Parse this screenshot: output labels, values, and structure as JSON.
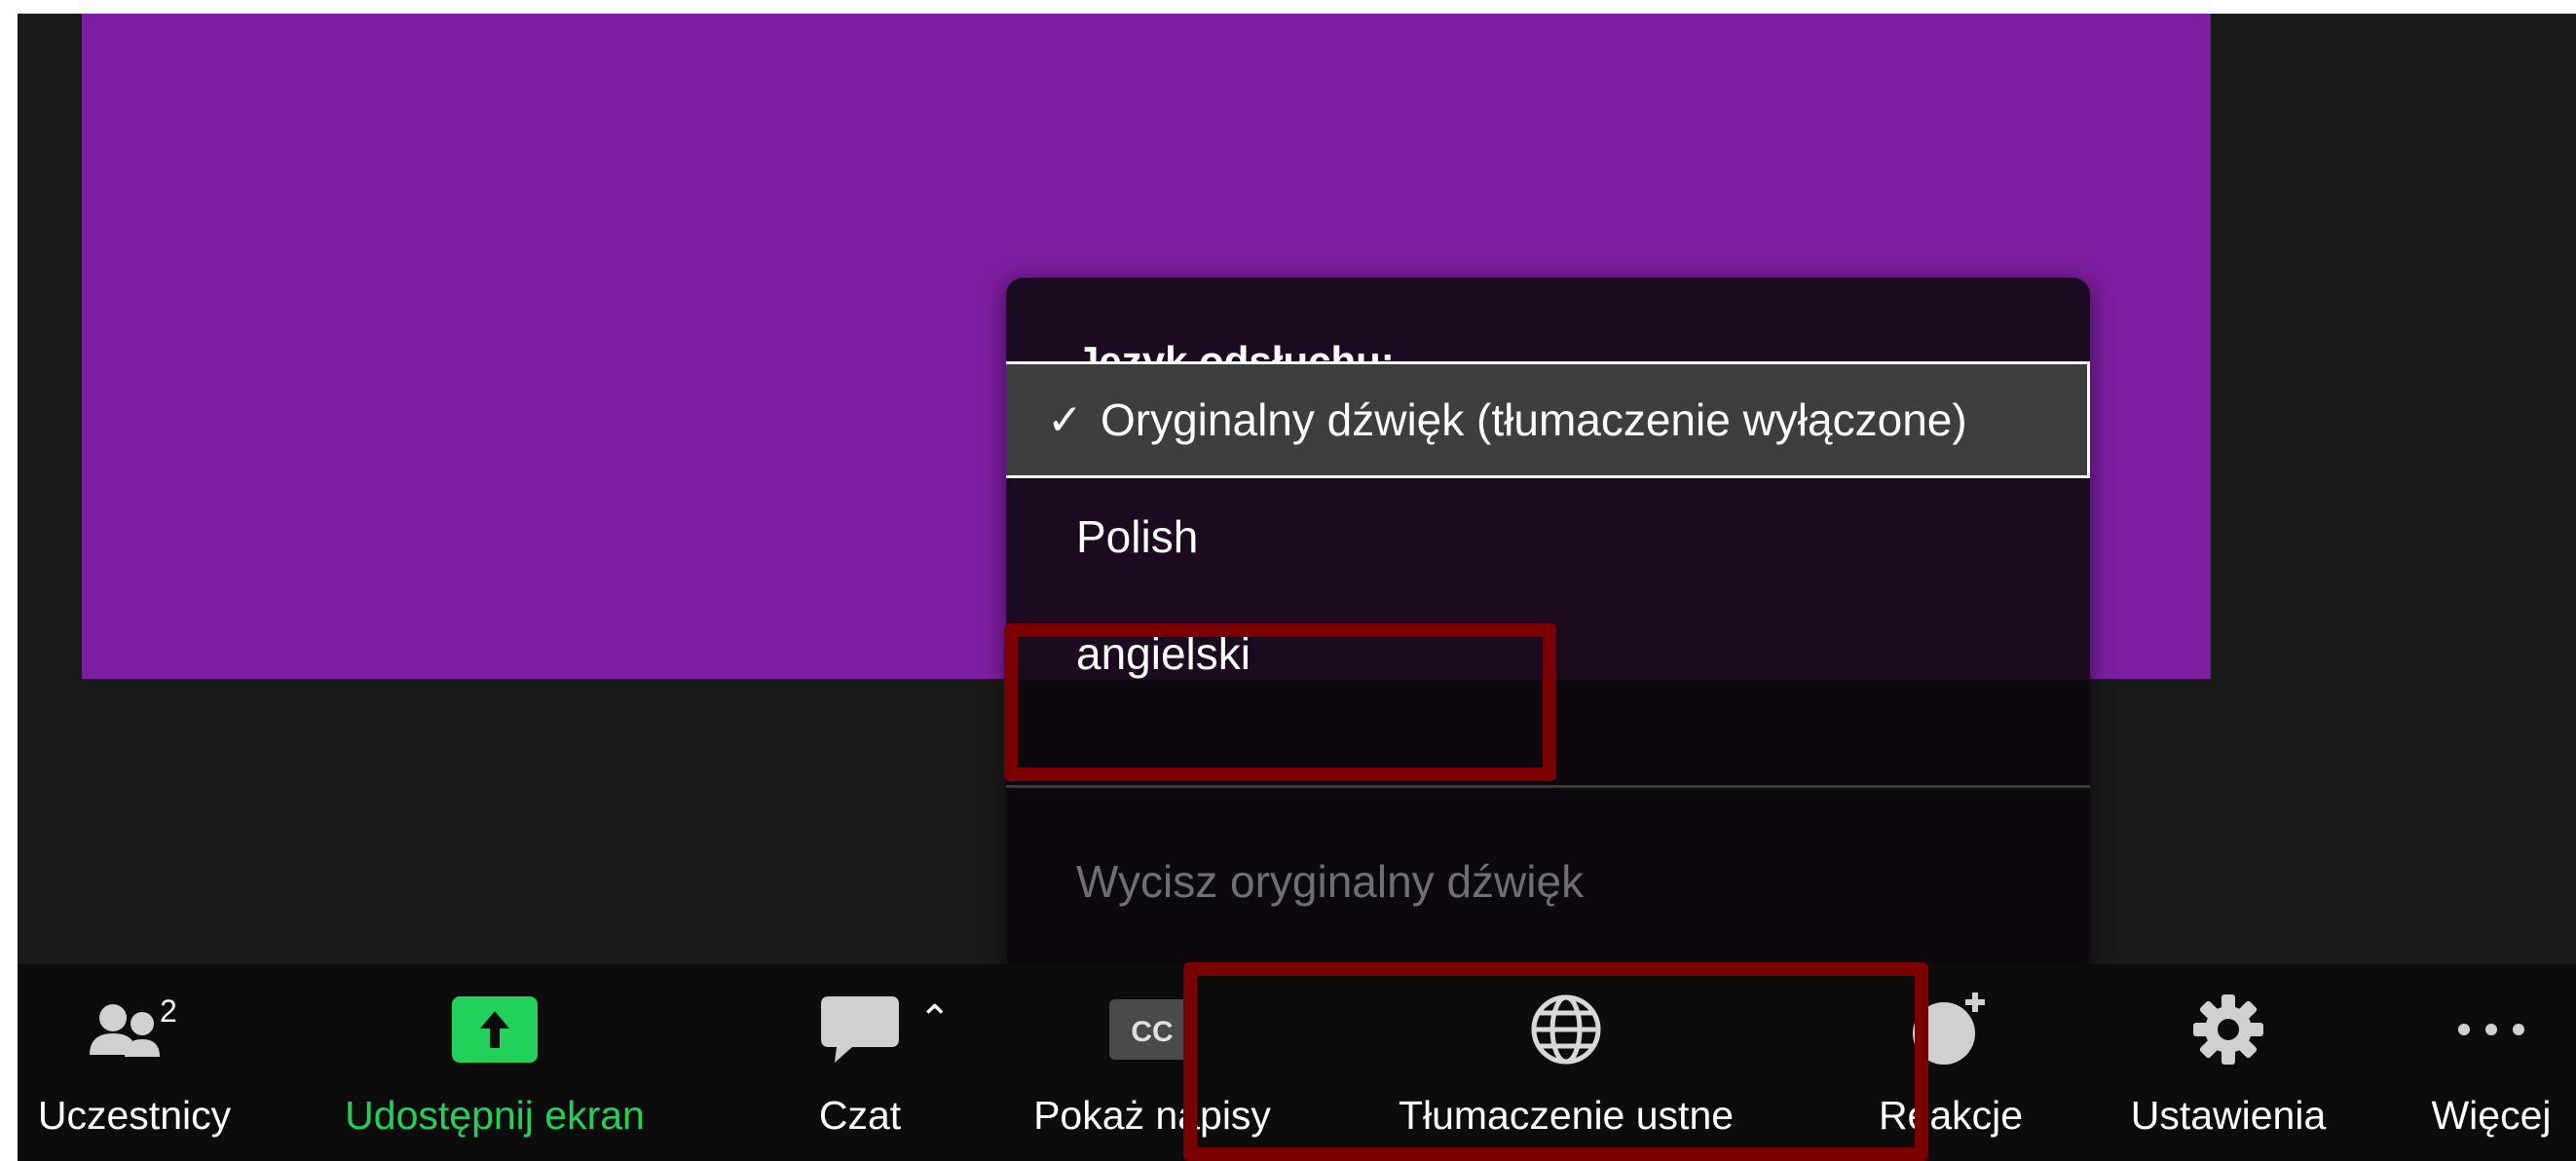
{
  "menu": {
    "title": "Język odsłuchu:",
    "check_mark": "✓",
    "items": [
      {
        "label": "Oryginalny dźwięk (tłumaczenie wyłączone)",
        "selected": true
      },
      {
        "label": "Polish",
        "selected": false
      },
      {
        "label": "angielski",
        "selected": false
      }
    ],
    "mute_original_label": "Wycisz oryginalny dźwięk"
  },
  "toolbar": {
    "participants_label": "Uczestnicy",
    "participants_count": "2",
    "share_label": "Udostępnij ekran",
    "chat_label": "Czat",
    "captions_label": "Pokaż napisy",
    "captions_icon_text": "CC",
    "interpretation_label": "Tłumaczenie ustne",
    "reactions_label": "Reakcje",
    "settings_label": "Ustawienia",
    "more_label": "Więcej"
  },
  "colors": {
    "video_background": "#7d1ea0",
    "share_green": "#22d15a",
    "highlight_border": "#7a0000"
  }
}
